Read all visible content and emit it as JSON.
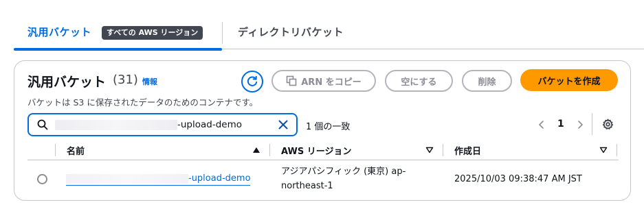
{
  "tabs": {
    "general_label": "汎用バケット",
    "region_badge": "すべての AWS リージョン",
    "directory_label": "ディレクトリバケット"
  },
  "panel": {
    "title": "汎用バケット",
    "count": "(31)",
    "info": "情報",
    "description": "バケットは S3 に保存されたデータのためのコンテナです。"
  },
  "actions": {
    "copy_arn": "ARN をコピー",
    "empty": "空にする",
    "delete": "削除",
    "create": "バケットを作成"
  },
  "search": {
    "value": "-upload-demo"
  },
  "results": {
    "match_text": "1 個の一致",
    "page": "1"
  },
  "table": {
    "headers": {
      "name": "名前",
      "region": "AWS リージョン",
      "created": "作成日"
    },
    "rows": [
      {
        "name": "-upload-demo",
        "region": "アジアパシフィック (東京) ap-northeast-1",
        "created": "2025/10/03 09:38:47 AM JST"
      }
    ]
  },
  "colors": {
    "accent": "#006ce0",
    "primary_button": "#ff9900",
    "badge": "#424650"
  },
  "icons": [
    "refresh-icon",
    "copy-icon",
    "search-icon",
    "close-icon",
    "chevron-left-icon",
    "chevron-right-icon",
    "gear-icon",
    "sort-ascending-icon",
    "sort-icon"
  ]
}
